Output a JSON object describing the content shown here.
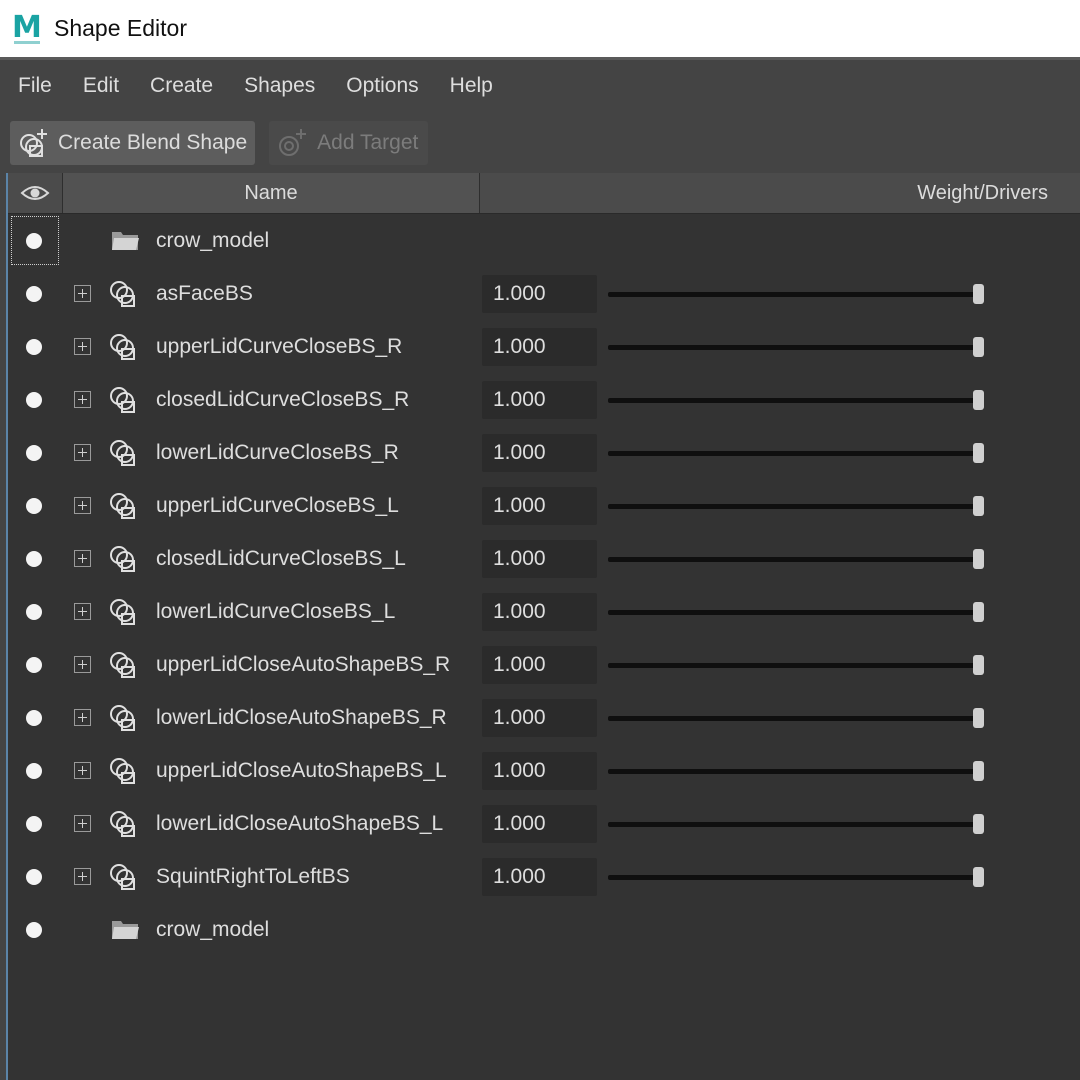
{
  "window": {
    "title": "Shape Editor",
    "app_logo_letter": "M"
  },
  "menu": [
    "File",
    "Edit",
    "Create",
    "Shapes",
    "Options",
    "Help"
  ],
  "toolbar": {
    "create_blend_shape": "Create Blend Shape",
    "add_target": "Add Target"
  },
  "columns": {
    "name": "Name",
    "weight": "Weight/Drivers"
  },
  "rows": [
    {
      "type": "group",
      "name": "crow_model",
      "focused": true
    },
    {
      "type": "blendshape",
      "name": "asFaceBS",
      "weight": "1.000",
      "slider": 1.0
    },
    {
      "type": "blendshape",
      "name": "upperLidCurveCloseBS_R",
      "weight": "1.000",
      "slider": 1.0
    },
    {
      "type": "blendshape",
      "name": "closedLidCurveCloseBS_R",
      "weight": "1.000",
      "slider": 1.0
    },
    {
      "type": "blendshape",
      "name": "lowerLidCurveCloseBS_R",
      "weight": "1.000",
      "slider": 1.0
    },
    {
      "type": "blendshape",
      "name": "upperLidCurveCloseBS_L",
      "weight": "1.000",
      "slider": 1.0
    },
    {
      "type": "blendshape",
      "name": "closedLidCurveCloseBS_L",
      "weight": "1.000",
      "slider": 1.0
    },
    {
      "type": "blendshape",
      "name": "lowerLidCurveCloseBS_L",
      "weight": "1.000",
      "slider": 1.0
    },
    {
      "type": "blendshape",
      "name": "upperLidCloseAutoShapeBS_R",
      "weight": "1.000",
      "slider": 1.0
    },
    {
      "type": "blendshape",
      "name": "lowerLidCloseAutoShapeBS_R",
      "weight": "1.000",
      "slider": 1.0
    },
    {
      "type": "blendshape",
      "name": "upperLidCloseAutoShapeBS_L",
      "weight": "1.000",
      "slider": 1.0
    },
    {
      "type": "blendshape",
      "name": "lowerLidCloseAutoShapeBS_L",
      "weight": "1.000",
      "slider": 1.0
    },
    {
      "type": "blendshape",
      "name": "SquintRightToLeftBS",
      "weight": "1.000",
      "slider": 1.0
    },
    {
      "type": "group",
      "name": "crow_model",
      "focused": false
    }
  ],
  "colors": {
    "panel_bg": "#444444",
    "list_bg": "#333333",
    "field_bg": "#2b2b2b",
    "logo_teal": "#1aa3a3",
    "focus_border": "#5b84a8"
  }
}
